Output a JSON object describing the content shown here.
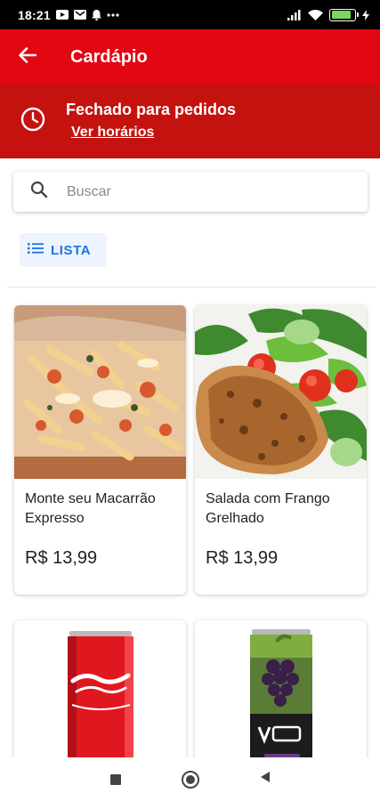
{
  "status_bar": {
    "time": "18:21",
    "battery_level": 0.85
  },
  "app_bar": {
    "title": "Cardápio",
    "back_icon": "arrow-left-icon"
  },
  "store_status": {
    "title": "Fechado para pedidos",
    "link": "Ver horários",
    "icon": "clock-icon"
  },
  "search": {
    "placeholder": "Buscar",
    "value": ""
  },
  "view_toggle": {
    "label": "LISTA",
    "icon": "list-icon"
  },
  "products": [
    {
      "name": "Monte seu Macarrão Expresso",
      "price": "R$ 13,99"
    },
    {
      "name": "Salada com Frango Grelhado",
      "price": "R$ 13,99"
    },
    {
      "name": "",
      "price": ""
    },
    {
      "name": "",
      "price": ""
    }
  ],
  "colors": {
    "primary": "#e30613",
    "banner": "#c4120f",
    "accent": "#1a73e8"
  }
}
